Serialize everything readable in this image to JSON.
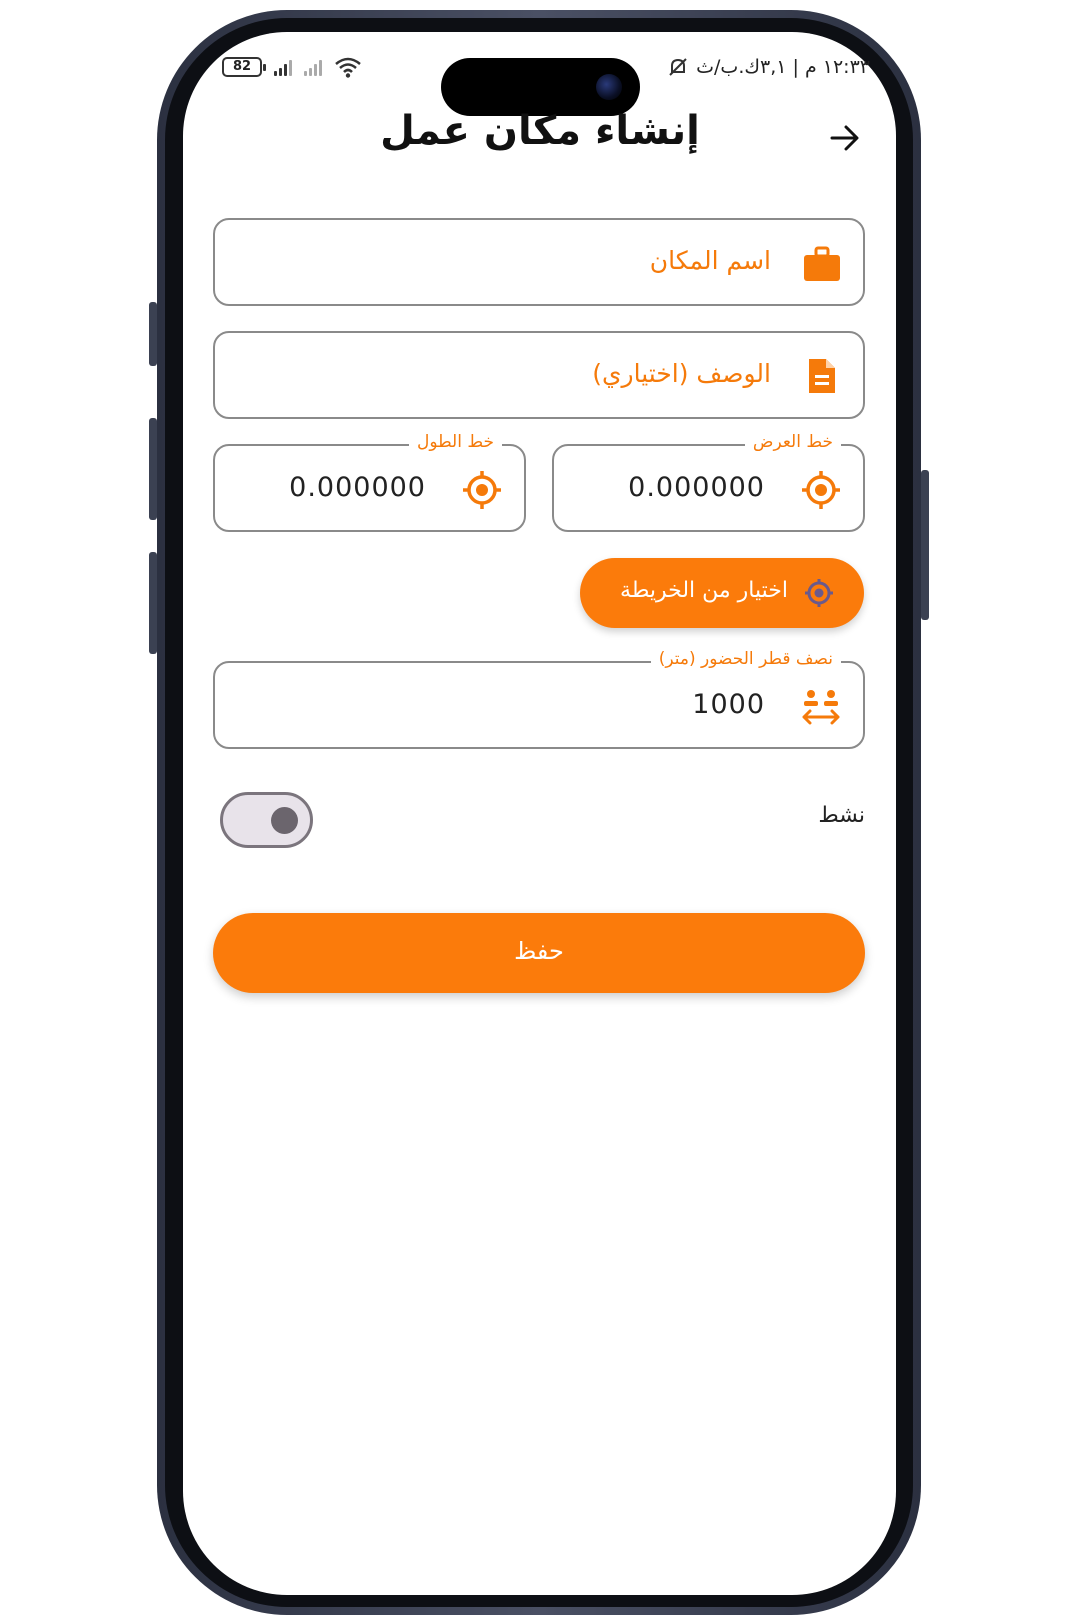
{
  "status_bar": {
    "time_text": "١٢:٣٣ م | ٣,١ك.ب/ث",
    "battery": "82"
  },
  "header": {
    "title": "إنشاء مكان عمل"
  },
  "form": {
    "place_name_placeholder": "اسم المكان",
    "description_placeholder": "الوصف (اختياري)",
    "latitude": {
      "label": "خط العرض",
      "value": "0.000000"
    },
    "longitude": {
      "label": "خط الطول",
      "value": "0.000000"
    },
    "pick_from_map_label": "اختيار من الخريطة",
    "radius": {
      "label": "نصف قطر الحضور (متر)",
      "value": "1000"
    },
    "active_label": "نشط",
    "active_on": false,
    "save_label": "حفظ"
  },
  "colors": {
    "accent": "#fb7b0b",
    "map_icon": "#6a5a8c"
  },
  "icons": {
    "back": "arrow-right-icon",
    "place": "briefcase-icon",
    "description": "document-icon",
    "coordinate": "crosshair-icon",
    "map": "target-icon",
    "radius": "radius-people-icon"
  }
}
